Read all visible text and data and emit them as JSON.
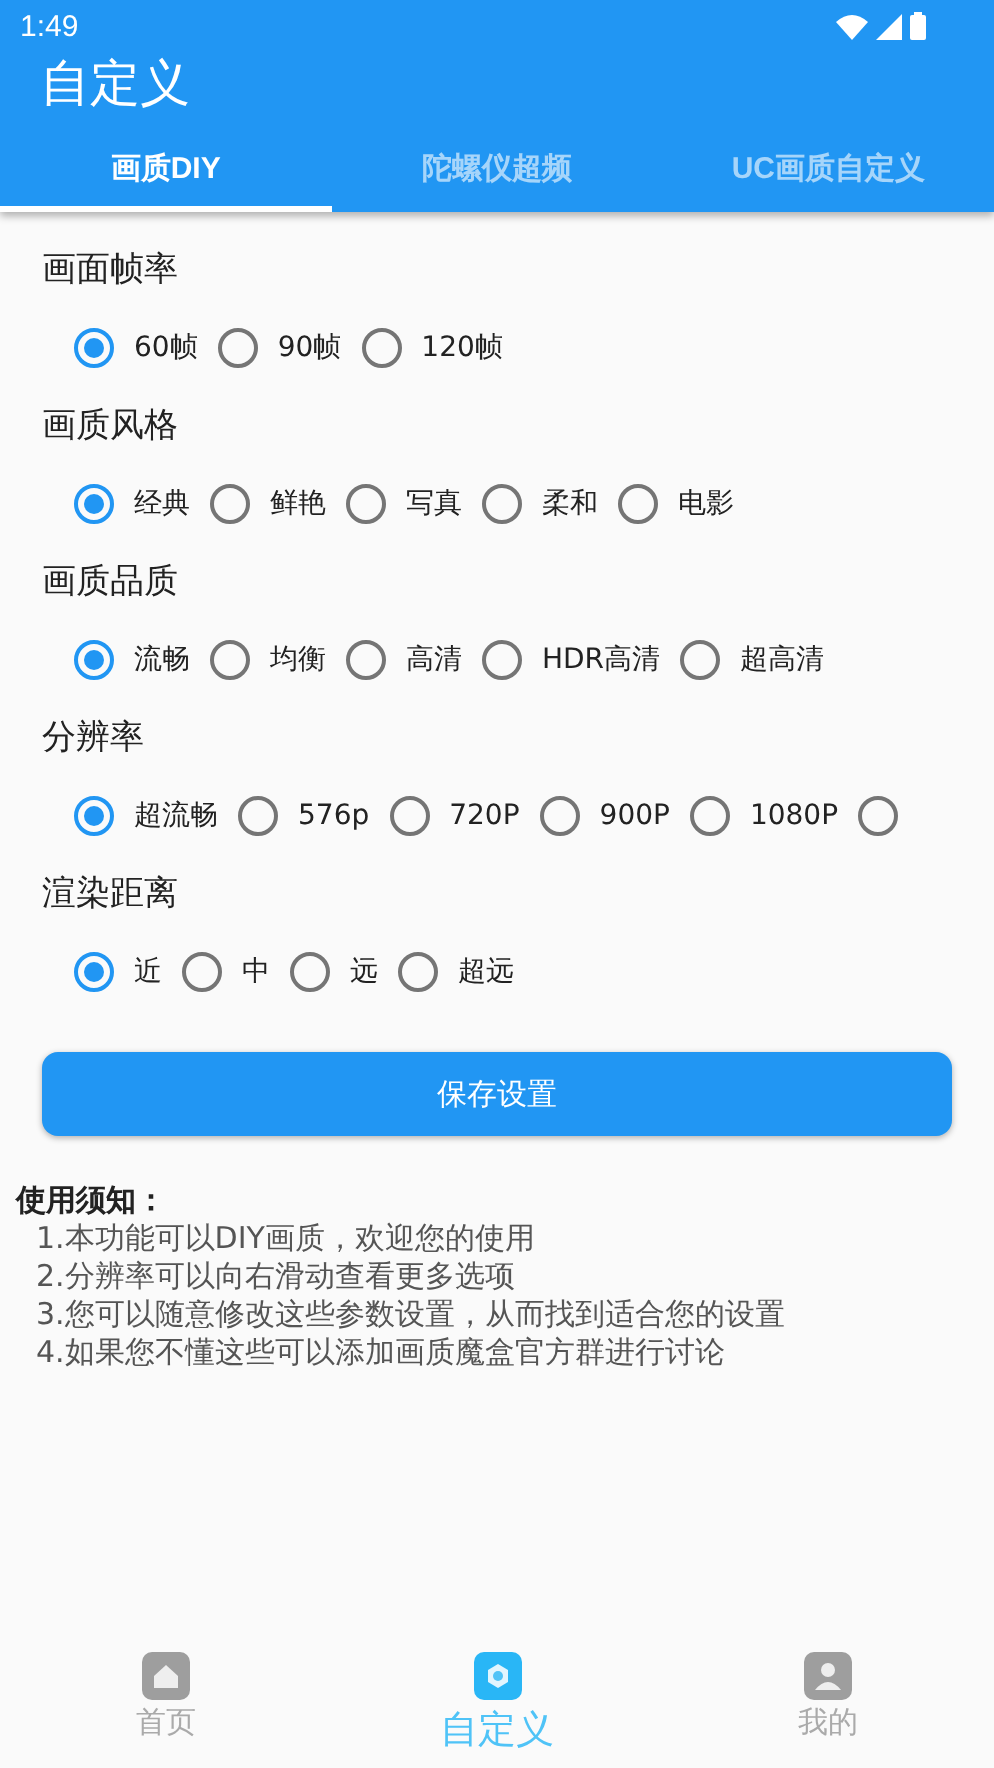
{
  "status_bar": {
    "time": "1:49"
  },
  "app_bar": {
    "title": "自定义"
  },
  "tabs": [
    {
      "label": "画质DIY",
      "selected": true
    },
    {
      "label": "陀螺仪超频",
      "selected": false
    },
    {
      "label": "UC画质自定义",
      "selected": false
    }
  ],
  "groups": [
    {
      "title": "画面帧率",
      "options": [
        {
          "label": "60帧",
          "selected": true
        },
        {
          "label": "90帧",
          "selected": false
        },
        {
          "label": "120帧",
          "selected": false
        }
      ]
    },
    {
      "title": "画质风格",
      "options": [
        {
          "label": "经典",
          "selected": true
        },
        {
          "label": "鲜艳",
          "selected": false
        },
        {
          "label": "写真",
          "selected": false
        },
        {
          "label": "柔和",
          "selected": false
        },
        {
          "label": "电影",
          "selected": false
        }
      ]
    },
    {
      "title": "画质品质",
      "options": [
        {
          "label": "流畅",
          "selected": true
        },
        {
          "label": "均衡",
          "selected": false
        },
        {
          "label": "高清",
          "selected": false
        },
        {
          "label": "HDR高清",
          "selected": false
        },
        {
          "label": "超高清",
          "selected": false
        }
      ]
    },
    {
      "title": "分辨率",
      "options": [
        {
          "label": "超流畅",
          "selected": true
        },
        {
          "label": "576p",
          "selected": false
        },
        {
          "label": "720P",
          "selected": false
        },
        {
          "label": "900P",
          "selected": false
        },
        {
          "label": "1080P",
          "selected": false
        },
        {
          "selected": false
        }
      ]
    },
    {
      "title": "渲染距离",
      "options": [
        {
          "label": "近",
          "selected": true
        },
        {
          "label": "中",
          "selected": false
        },
        {
          "label": "远",
          "selected": false
        },
        {
          "label": "超远",
          "selected": false
        }
      ]
    }
  ],
  "save_button": "保存设置",
  "notes": {
    "title": "使用须知：",
    "lines": [
      "1.本功能可以DIY画质，欢迎您的使用",
      "2.分辨率可以向右滑动查看更多选项",
      "3.您可以随意修改这些参数设置，从而找到适合您的设置",
      "4.如果您不懂这些可以添加画质魔盒官方群进行讨论"
    ]
  },
  "bottom_nav": [
    {
      "label": "首页",
      "kind": "home",
      "selected": false
    },
    {
      "label": "自定义",
      "kind": "settings",
      "selected": true
    },
    {
      "label": "我的",
      "kind": "profile",
      "selected": false
    }
  ]
}
